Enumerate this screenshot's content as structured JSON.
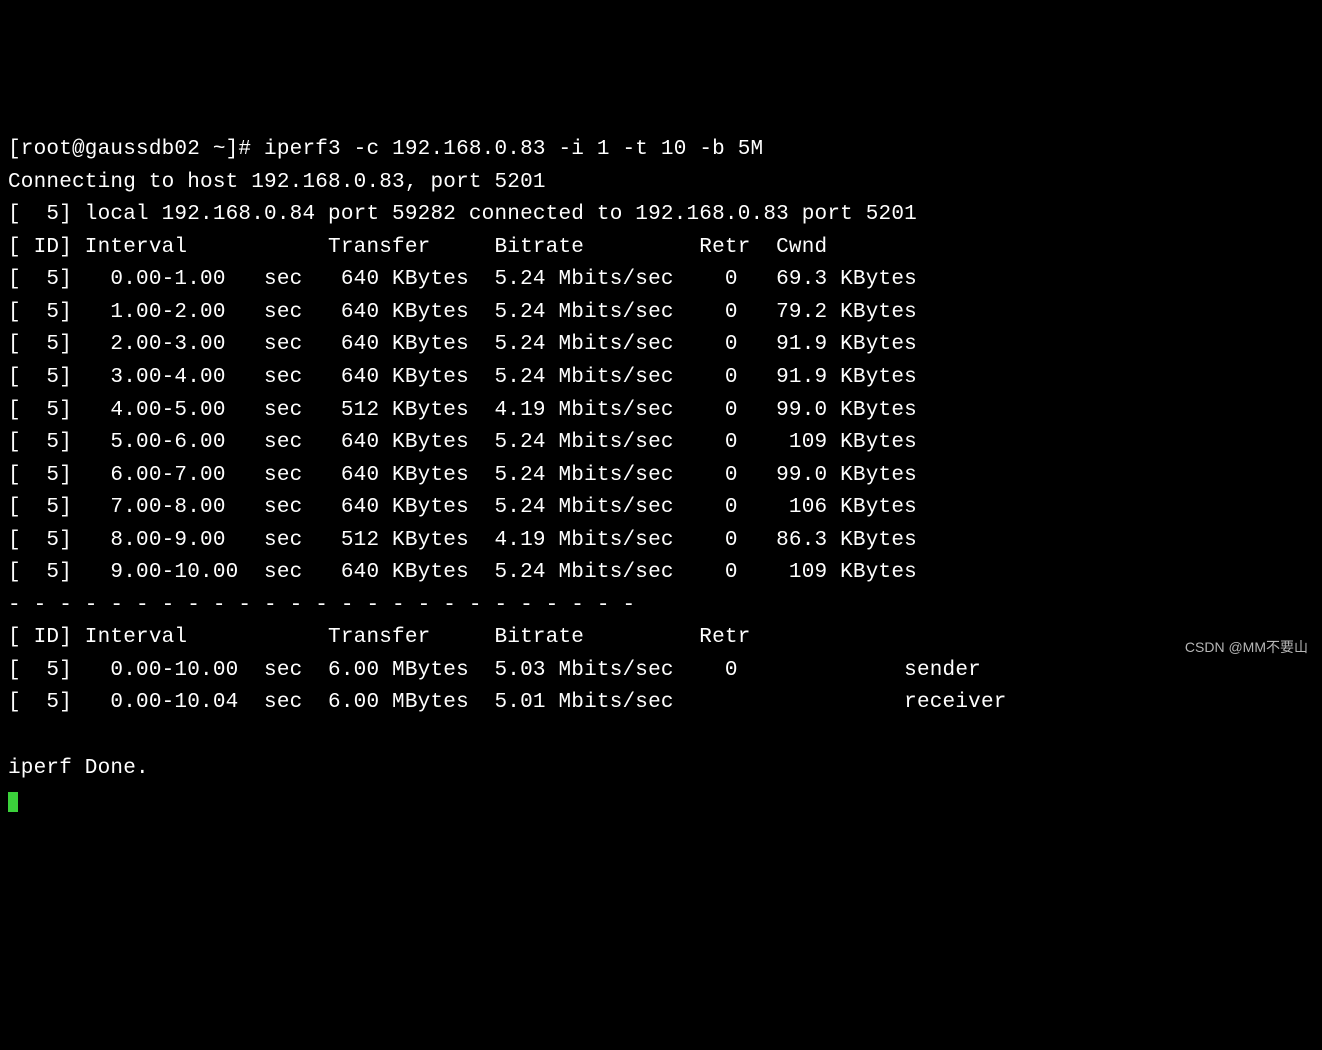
{
  "prompt": "[root@gaussdb02 ~]# ",
  "command": "iperf3 -c 192.168.0.83 -i 1 -t 10 -b 5M",
  "connecting": "Connecting to host 192.168.0.83, port 5201",
  "local_line": "[  5] local 192.168.0.84 port 59282 connected to 192.168.0.83 port 5201",
  "header1": "[ ID] Interval           Transfer     Bitrate         Retr  Cwnd",
  "rows": [
    "[  5]   0.00-1.00   sec   640 KBytes  5.24 Mbits/sec    0   69.3 KBytes",
    "[  5]   1.00-2.00   sec   640 KBytes  5.24 Mbits/sec    0   79.2 KBytes",
    "[  5]   2.00-3.00   sec   640 KBytes  5.24 Mbits/sec    0   91.9 KBytes",
    "[  5]   3.00-4.00   sec   640 KBytes  5.24 Mbits/sec    0   91.9 KBytes",
    "[  5]   4.00-5.00   sec   512 KBytes  4.19 Mbits/sec    0   99.0 KBytes",
    "[  5]   5.00-6.00   sec   640 KBytes  5.24 Mbits/sec    0    109 KBytes",
    "[  5]   6.00-7.00   sec   640 KBytes  5.24 Mbits/sec    0   99.0 KBytes",
    "[  5]   7.00-8.00   sec   640 KBytes  5.24 Mbits/sec    0    106 KBytes",
    "[  5]   8.00-9.00   sec   512 KBytes  4.19 Mbits/sec    0   86.3 KBytes",
    "[  5]   9.00-10.00  sec   640 KBytes  5.24 Mbits/sec    0    109 KBytes"
  ],
  "divider": "- - - - - - - - - - - - - - - - - - - - - - - - -",
  "header2": "[ ID] Interval           Transfer     Bitrate         Retr",
  "summary_rows": [
    "[  5]   0.00-10.00  sec  6.00 MBytes  5.03 Mbits/sec    0             sender",
    "[  5]   0.00-10.04  sec  6.00 MBytes  5.01 Mbits/sec                  receiver"
  ],
  "blank": "",
  "done": "iperf Done.",
  "watermark": "CSDN @MM不要山",
  "chart_data": {
    "type": "table",
    "title": "iperf3 interval report",
    "columns": [
      "ID",
      "Interval",
      "Transfer",
      "Bitrate",
      "Retr",
      "Cwnd"
    ],
    "rows": [
      {
        "id": 5,
        "interval": "0.00-1.00 sec",
        "transfer": "640 KBytes",
        "bitrate": "5.24 Mbits/sec",
        "retr": 0,
        "cwnd": "69.3 KBytes"
      },
      {
        "id": 5,
        "interval": "1.00-2.00 sec",
        "transfer": "640 KBytes",
        "bitrate": "5.24 Mbits/sec",
        "retr": 0,
        "cwnd": "79.2 KBytes"
      },
      {
        "id": 5,
        "interval": "2.00-3.00 sec",
        "transfer": "640 KBytes",
        "bitrate": "5.24 Mbits/sec",
        "retr": 0,
        "cwnd": "91.9 KBytes"
      },
      {
        "id": 5,
        "interval": "3.00-4.00 sec",
        "transfer": "640 KBytes",
        "bitrate": "5.24 Mbits/sec",
        "retr": 0,
        "cwnd": "91.9 KBytes"
      },
      {
        "id": 5,
        "interval": "4.00-5.00 sec",
        "transfer": "512 KBytes",
        "bitrate": "4.19 Mbits/sec",
        "retr": 0,
        "cwnd": "99.0 KBytes"
      },
      {
        "id": 5,
        "interval": "5.00-6.00 sec",
        "transfer": "640 KBytes",
        "bitrate": "5.24 Mbits/sec",
        "retr": 0,
        "cwnd": "109 KBytes"
      },
      {
        "id": 5,
        "interval": "6.00-7.00 sec",
        "transfer": "640 KBytes",
        "bitrate": "5.24 Mbits/sec",
        "retr": 0,
        "cwnd": "99.0 KBytes"
      },
      {
        "id": 5,
        "interval": "7.00-8.00 sec",
        "transfer": "640 KBytes",
        "bitrate": "5.24 Mbits/sec",
        "retr": 0,
        "cwnd": "106 KBytes"
      },
      {
        "id": 5,
        "interval": "8.00-9.00 sec",
        "transfer": "512 KBytes",
        "bitrate": "4.19 Mbits/sec",
        "retr": 0,
        "cwnd": "86.3 KBytes"
      },
      {
        "id": 5,
        "interval": "9.00-10.00 sec",
        "transfer": "640 KBytes",
        "bitrate": "5.24 Mbits/sec",
        "retr": 0,
        "cwnd": "109 KBytes"
      }
    ],
    "summary": [
      {
        "id": 5,
        "interval": "0.00-10.00 sec",
        "transfer": "6.00 MBytes",
        "bitrate": "5.03 Mbits/sec",
        "retr": 0,
        "role": "sender"
      },
      {
        "id": 5,
        "interval": "0.00-10.04 sec",
        "transfer": "6.00 MBytes",
        "bitrate": "5.01 Mbits/sec",
        "retr": null,
        "role": "receiver"
      }
    ]
  }
}
